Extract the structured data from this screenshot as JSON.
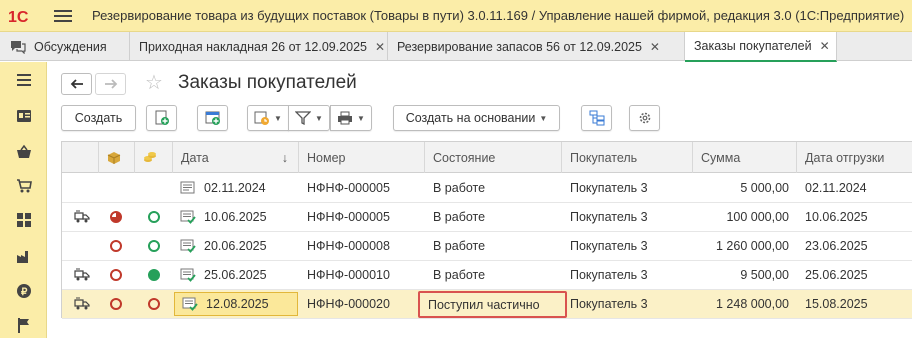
{
  "app": {
    "logo_text": "1С",
    "title": "Резервирование товара из будущих поставок (Товары в пути) 3.0.11.169 / Управление нашей фирмой, редакция 3.0  (1С:Предприятие)"
  },
  "tabs": [
    {
      "label": "Обсуждения"
    },
    {
      "label": "Приходная накладная 26 от 12.09.2025"
    },
    {
      "label": "Резервирование запасов 56 от 12.09.2025"
    },
    {
      "label": "Заказы покупателей",
      "active": true
    }
  ],
  "page": {
    "title": "Заказы покупателей"
  },
  "toolbar": {
    "create": "Создать",
    "create_based_on": "Создать на основании"
  },
  "table": {
    "columns": [
      "Дата",
      "Номер",
      "Состояние",
      "Покупатель",
      "Сумма",
      "Дата отгрузки"
    ],
    "sort_indicator": "↓",
    "rows": [
      {
        "date": "02.11.2024",
        "number": "НФНФ-000005",
        "state": "В работе",
        "customer": "Покупатель 3",
        "sum": "5 000,00",
        "ship": "02.11.2024",
        "truck": false,
        "reserve": "none",
        "payment": "none",
        "posted": false
      },
      {
        "date": "10.06.2025",
        "number": "НФНФ-000005",
        "state": "В работе",
        "customer": "Покупатель 3",
        "sum": "100 000,00",
        "ship": "10.06.2025",
        "truck": true,
        "reserve": "partial",
        "payment": "empty-green",
        "posted": true
      },
      {
        "date": "20.06.2025",
        "number": "НФНФ-000008",
        "state": "В работе",
        "customer": "Покупатель 3",
        "sum": "1 260 000,00",
        "ship": "23.06.2025",
        "truck": false,
        "reserve": "empty-red",
        "payment": "empty-green",
        "posted": true
      },
      {
        "date": "25.06.2025",
        "number": "НФНФ-000010",
        "state": "В работе",
        "customer": "Покупатель 3",
        "sum": "9 500,00",
        "ship": "25.06.2025",
        "truck": true,
        "reserve": "empty-red",
        "payment": "full-green",
        "posted": true
      },
      {
        "date": "12.08.2025",
        "number": "НФНФ-000020",
        "state": "Поступил частично",
        "customer": "Покупатель 3",
        "sum": "1 248 000,00",
        "ship": "15.08.2025",
        "truck": true,
        "reserve": "empty-red",
        "payment": "empty-red",
        "posted": true,
        "selected": true
      }
    ]
  },
  "colors": {
    "accent_green": "#26a05a",
    "red": "#c0392b",
    "highlight_border": "#d9534f",
    "title_bg": "#fbeda8"
  }
}
